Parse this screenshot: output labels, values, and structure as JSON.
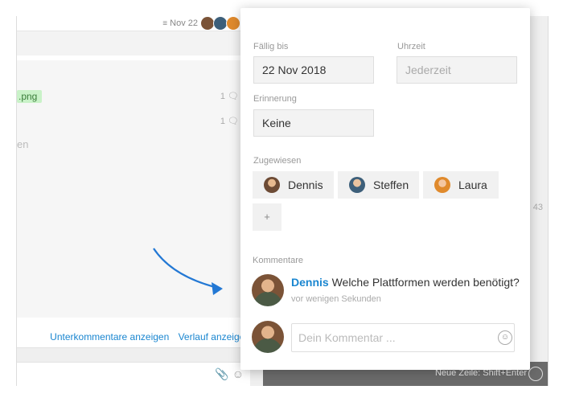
{
  "background": {
    "topbar_date": "Nov 22",
    "file_chip": ".png",
    "comment_counts": [
      "1",
      "1"
    ],
    "text_fragment": "en",
    "links": {
      "subcomments": "Unterkommentare anzeigen",
      "history": "Verlauf anzeigen"
    },
    "time_fragment": "43",
    "newline_hint": "Neue Zeile: Shift+Enter"
  },
  "task": {
    "due_label": "Fällig bis",
    "due_value": "22 Nov 2018",
    "time_label": "Uhrzeit",
    "time_value": "Jederzeit",
    "reminder_label": "Erinnerung",
    "reminder_value": "Keine",
    "assigned_label": "Zugewiesen",
    "assignees": [
      "Dennis",
      "Steffen",
      "Laura"
    ],
    "add_assignee": "+",
    "comments_label": "Kommentare",
    "comment": {
      "author": "Dennis",
      "text": "Welche Plattformen werden benötigt?",
      "time": "vor wenigen Sekunden"
    },
    "comment_placeholder": "Dein Kommentar ..."
  },
  "colors": {
    "accent": "#1a86d0",
    "arrow": "#2378d4",
    "chip_green": "#c9f2c8"
  },
  "icons": {
    "comment": "speech-bubble-icon",
    "emoji": "smiley-icon",
    "attach": "paperclip-icon",
    "sort": "sort-lines-icon"
  }
}
